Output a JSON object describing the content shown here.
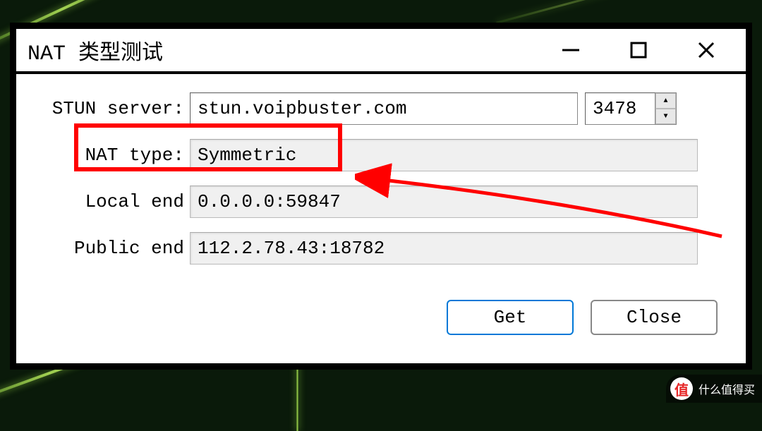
{
  "window": {
    "title": "NAT 类型测试"
  },
  "labels": {
    "stun_server": "STUN server:",
    "nat_type": "NAT type:",
    "local_end": "Local end",
    "public_end": "Public end"
  },
  "values": {
    "stun_server": "stun.voipbuster.com",
    "port": "3478",
    "nat_type": "Symmetric",
    "local_end": "0.0.0.0:59847",
    "public_end": "112.2.78.43:18782"
  },
  "buttons": {
    "get": "Get",
    "close": "Close"
  },
  "watermark": {
    "badge": "值",
    "text": "什么值得买"
  },
  "annotations": {
    "highlight_color": "#ff0000",
    "arrow_color": "#ff0000"
  }
}
